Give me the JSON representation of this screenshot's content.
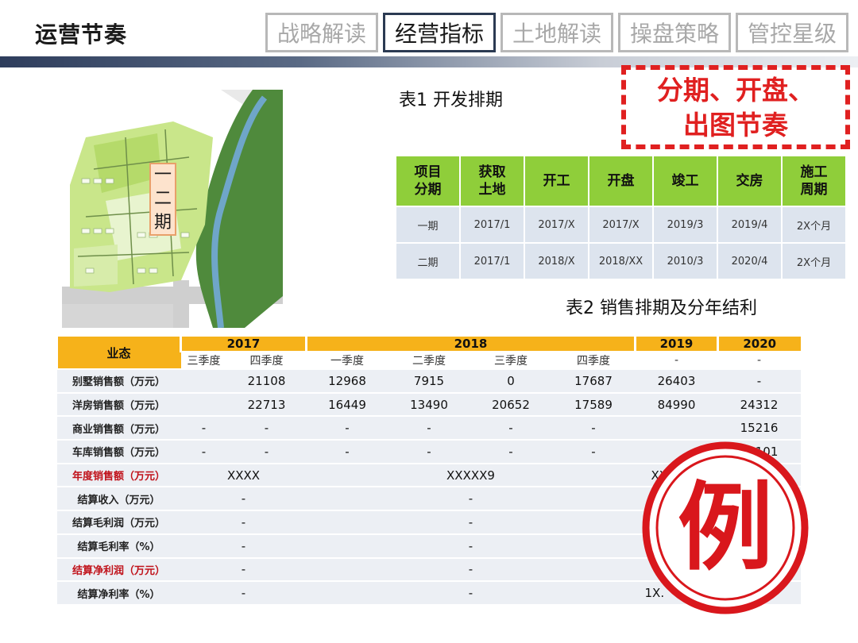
{
  "header": {
    "title": "运营节奏",
    "tabs": [
      {
        "label": "战略解读",
        "active": false
      },
      {
        "label": "经营指标",
        "active": true
      },
      {
        "label": "土地解读",
        "active": false
      },
      {
        "label": "操盘策略",
        "active": false
      },
      {
        "label": "管控星级",
        "active": false
      }
    ]
  },
  "map": {
    "phase_label": [
      "一",
      "二",
      "期"
    ]
  },
  "callout": {
    "line1": "分期、开盘、",
    "line2": "出图节奏"
  },
  "table1": {
    "title": "表1 开发排期",
    "headers": [
      "项目\n分期",
      "获取\n土地",
      "开工",
      "开盘",
      "竣工",
      "交房",
      "施工\n周期"
    ],
    "rows": [
      [
        "一期",
        "2017/1",
        "2017/X",
        "2017/X",
        "2019/3",
        "2019/4",
        "2X个月"
      ],
      [
        "二期",
        "2017/1",
        "2018/X",
        "2018/XX",
        "2010/3",
        "2020/4",
        "2X个月"
      ]
    ]
  },
  "table2": {
    "title": "表2 销售排期及分年结利",
    "corner": "业态",
    "years": [
      "2017",
      "2018",
      "2019",
      "2020"
    ],
    "quarters": [
      "三季度",
      "四季度",
      "一季度",
      "二季度",
      "三季度",
      "四季度",
      "-",
      "-"
    ],
    "rows": [
      {
        "label": "别墅销售额（万元）",
        "cells": [
          "",
          "21108",
          "12968",
          "7915",
          "0",
          "17687",
          "26403",
          "-"
        ]
      },
      {
        "label": "洋房销售额（万元）",
        "cells": [
          "",
          "22713",
          "16449",
          "13490",
          "20652",
          "17589",
          "84990",
          "24312"
        ]
      },
      {
        "label": "商业销售额（万元）",
        "cells": [
          "-",
          "-",
          "-",
          "-",
          "-",
          "-",
          "",
          "15216"
        ]
      },
      {
        "label": "车库销售额（万元）",
        "cells": [
          "-",
          "-",
          "-",
          "-",
          "-",
          "-",
          "",
          "21101"
        ]
      }
    ],
    "merged_rows": [
      {
        "label": "年度销售额（万元）",
        "red": true,
        "v2017": "XXXX",
        "v2018": "XXXXX9",
        "v2019": "XX"
      },
      {
        "label": "结算收入（万元）",
        "red": false,
        "v2017": "-",
        "v2018": "-",
        "v2019": ""
      },
      {
        "label": "结算毛利润（万元）",
        "red": false,
        "v2017": "-",
        "v2018": "-",
        "v2019": ""
      },
      {
        "label": "结算毛利率（%）",
        "red": false,
        "v2017": "-",
        "v2018": "-",
        "v2019": ""
      },
      {
        "label": "结算净利润（万元）",
        "red": true,
        "v2017": "-",
        "v2018": "-",
        "v2019": ""
      },
      {
        "label": "结算净利率（%）",
        "red": false,
        "v2017": "-",
        "v2018": "-",
        "v2019": "1X."
      }
    ]
  },
  "stamp": {
    "text": "例"
  },
  "colors": {
    "accent_red": "#e02020",
    "table1_header": "#8fce3a",
    "table2_year": "#f6b21a",
    "nav_active": "#2b3a52"
  }
}
